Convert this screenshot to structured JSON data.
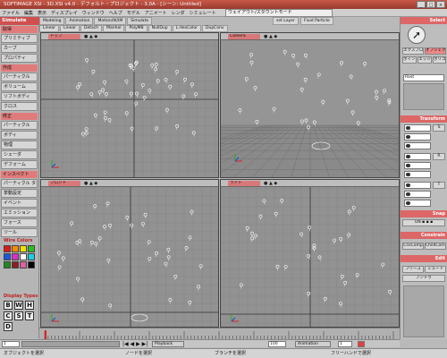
{
  "window": {
    "title": "SOFTIMAGE XSI - 3D.XSI v4.0 - デフォルト・プロジェクト - 3.0A - [シーン: Untitled]",
    "buttons": [
      "_",
      "□",
      "×"
    ]
  },
  "menubar": {
    "items": [
      "ファイル",
      "編集",
      "表示",
      "ディスプレイ",
      "ウィンドウ",
      "ヘルプ",
      "モデル",
      "アニメート",
      "レンダ",
      "シミュレート"
    ],
    "preset": "ウェイアウト/スタウントモード"
  },
  "module": {
    "current": "Simulate",
    "tabs": [
      "Modeling",
      "Animation",
      "Motion/IK/IM",
      "Simulate"
    ],
    "subtools": [
      "Linear",
      "Linear",
      "Detach",
      "Manhol",
      "PolyMB",
      "NullDup",
      "L.HexColor",
      "DupConv"
    ],
    "right_buttons": [
      "set Layer",
      "Fluid Particle"
    ]
  },
  "left_panel": {
    "section_get": "取得",
    "section_create": "作成",
    "section_modify": "修正",
    "section_inspect": "インスペクト",
    "buttons_get": [
      "プリミティブ",
      "カーブ",
      "プロパティ"
    ],
    "buttons_create": [
      "パーティクル",
      "ボリューム",
      "ソフトボディ",
      "クロス"
    ],
    "buttons_modify": [
      "パーティクル",
      "ボディ",
      "物理",
      "シェーダ",
      "デフォーム"
    ],
    "buttons_inspect": [
      "パーティクル タイプ",
      "挙動設定",
      "イベント",
      "エミッション",
      "フォース",
      "ツール"
    ],
    "wire_colors_label": "Wire Colors",
    "wire_colors": [
      "#e01818",
      "#ff8a00",
      "#f0e000",
      "#26c020",
      "#1a58e0",
      "#d830c8",
      "#ffffff",
      "#18d0e0",
      "#208a20",
      "#8a2020",
      "#e060a0",
      "#000000"
    ],
    "display_types_label": "Display Types",
    "display_types": [
      "B",
      "W",
      "H",
      "C",
      "S",
      "T",
      "D"
    ]
  },
  "viewports": [
    {
      "title": "トップ",
      "mode": "ワイヤー",
      "view": "ortho-top"
    },
    {
      "title": "Camera",
      "mode": "ワイヤー",
      "view": "camera"
    },
    {
      "title": "フロント",
      "mode": "ワイヤー",
      "view": "ortho-front"
    },
    {
      "title": "ライト",
      "mode": "ワイヤー",
      "view": "ortho-right"
    }
  ],
  "right_panel": {
    "header_select": "Select",
    "select_buttons": [
      "エクスプローラ",
      "オブジェクト",
      "ポイント",
      "エッジ",
      "ポリゴン"
    ],
    "header_transform": "Transform",
    "transform_fields": [
      "S",
      "R",
      "T"
    ],
    "header_snap": "Snap",
    "header_constrain": "Constrain",
    "constrain_buttons": [
      "CnsComp",
      "ChildComp"
    ],
    "header_edit": "Edit",
    "edit_buttons": [
      "フリーズ",
      "ミュート",
      "アンドゥ"
    ],
    "selection_field": "Root"
  },
  "timeline": {
    "start": "1",
    "end": "100",
    "current": "1",
    "frame_field": "100",
    "playback_label": "Playback",
    "animation_label": "Animation",
    "speed": "1"
  },
  "statusbar": {
    "left": "オブジェクトを選択",
    "mid1": "ノードを選択",
    "mid2": "ブランチを選択",
    "right": "フリーハンドで選択"
  },
  "colors": {
    "accent": "#d66060",
    "viewport_bg": "#929292"
  }
}
